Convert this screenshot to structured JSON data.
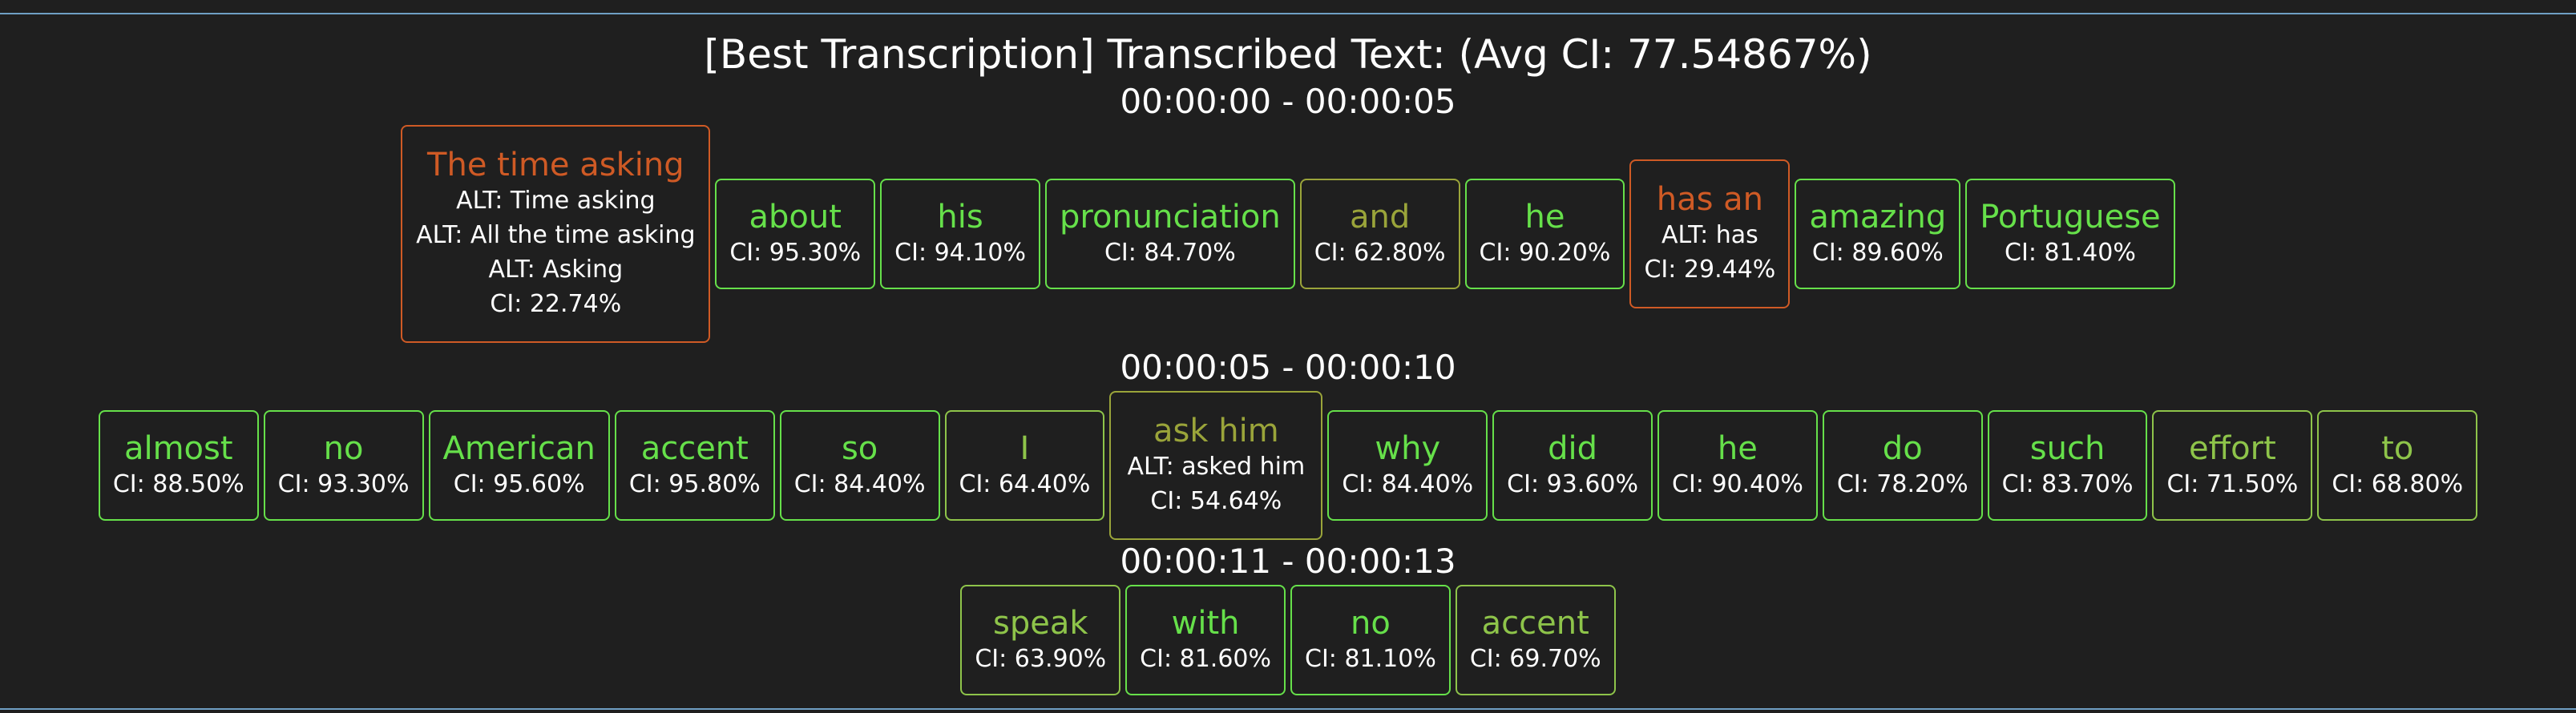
{
  "title": "[Best Transcription] Transcribed Text: (Avg CI: 77.54867%)",
  "colors": {
    "background": "#1f1f1f",
    "high": "#66e04a",
    "medium": "#8ec44a",
    "olive": "#9aa43a",
    "low": "#cf5a25",
    "rule": "#6f9fc4"
  },
  "segments": [
    {
      "time": "00:00:00 - 00:00:05",
      "words": [
        {
          "text": "The time asking",
          "alts": [
            "ALT: Time asking",
            "ALT: All the time asking",
            "ALT: Asking"
          ],
          "ci": "CI: 22.74%",
          "tone": "low"
        },
        {
          "text": "about",
          "alts": [],
          "ci": "CI: 95.30%",
          "tone": "hi"
        },
        {
          "text": "his",
          "alts": [],
          "ci": "CI: 94.10%",
          "tone": "hi"
        },
        {
          "text": "pronunciation",
          "alts": [],
          "ci": "CI: 84.70%",
          "tone": "hi"
        },
        {
          "text": "and",
          "alts": [],
          "ci": "CI: 62.80%",
          "tone": "olive"
        },
        {
          "text": "he",
          "alts": [],
          "ci": "CI: 90.20%",
          "tone": "hi"
        },
        {
          "text": "has an",
          "alts": [
            "ALT: has"
          ],
          "ci": "CI: 29.44%",
          "tone": "low"
        },
        {
          "text": "amazing",
          "alts": [],
          "ci": "CI: 89.60%",
          "tone": "hi"
        },
        {
          "text": "Portuguese",
          "alts": [],
          "ci": "CI: 81.40%",
          "tone": "hi"
        }
      ]
    },
    {
      "time": "00:00:05 - 00:00:10",
      "words": [
        {
          "text": "almost",
          "alts": [],
          "ci": "CI: 88.50%",
          "tone": "hi"
        },
        {
          "text": "no",
          "alts": [],
          "ci": "CI: 93.30%",
          "tone": "hi"
        },
        {
          "text": "American",
          "alts": [],
          "ci": "CI: 95.60%",
          "tone": "hi"
        },
        {
          "text": "accent",
          "alts": [],
          "ci": "CI: 95.80%",
          "tone": "hi"
        },
        {
          "text": "so",
          "alts": [],
          "ci": "CI: 84.40%",
          "tone": "hi"
        },
        {
          "text": "I",
          "alts": [],
          "ci": "CI: 64.40%",
          "tone": "mid"
        },
        {
          "text": "ask him",
          "alts": [
            "ALT: asked him"
          ],
          "ci": "CI: 54.64%",
          "tone": "olive"
        },
        {
          "text": "why",
          "alts": [],
          "ci": "CI: 84.40%",
          "tone": "hi"
        },
        {
          "text": "did",
          "alts": [],
          "ci": "CI: 93.60%",
          "tone": "hi"
        },
        {
          "text": "he",
          "alts": [],
          "ci": "CI: 90.40%",
          "tone": "hi"
        },
        {
          "text": "do",
          "alts": [],
          "ci": "CI: 78.20%",
          "tone": "hi"
        },
        {
          "text": "such",
          "alts": [],
          "ci": "CI: 83.70%",
          "tone": "hi"
        },
        {
          "text": "effort",
          "alts": [],
          "ci": "CI: 71.50%",
          "tone": "mid"
        },
        {
          "text": "to",
          "alts": [],
          "ci": "CI: 68.80%",
          "tone": "mid"
        }
      ]
    },
    {
      "time": "00:00:11 - 00:00:13",
      "words": [
        {
          "text": "speak",
          "alts": [],
          "ci": "CI: 63.90%",
          "tone": "mid"
        },
        {
          "text": "with",
          "alts": [],
          "ci": "CI: 81.60%",
          "tone": "hi"
        },
        {
          "text": "no",
          "alts": [],
          "ci": "CI: 81.10%",
          "tone": "hi"
        },
        {
          "text": "accent",
          "alts": [],
          "ci": "CI: 69.70%",
          "tone": "mid"
        }
      ]
    }
  ]
}
